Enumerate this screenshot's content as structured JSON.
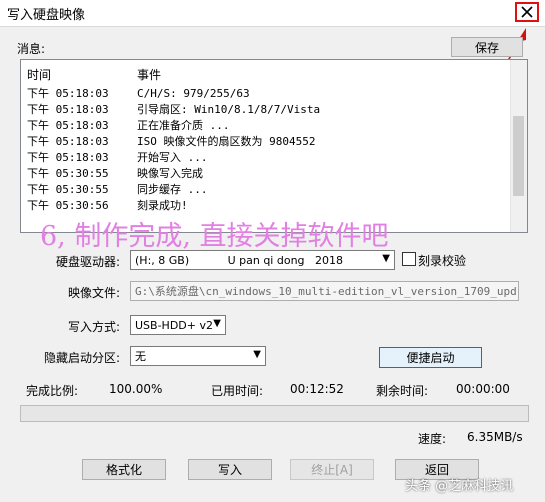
{
  "window": {
    "title": "写入硬盘映像"
  },
  "messages": {
    "label": "消息:",
    "save_label": "保存",
    "columns": {
      "time": "时间",
      "event": "事件"
    },
    "rows": [
      {
        "time": "下午 05:18:03",
        "event": "C/H/S: 979/255/63"
      },
      {
        "time": "下午 05:18:03",
        "event": "引导扇区: Win10/8.1/8/7/Vista"
      },
      {
        "time": "下午 05:18:03",
        "event": "正在准备介质 ..."
      },
      {
        "time": "下午 05:18:03",
        "event": "ISO 映像文件的扇区数为 9804552"
      },
      {
        "time": "下午 05:18:03",
        "event": "开始写入 ..."
      },
      {
        "time": "下午 05:30:55",
        "event": "映像写入完成"
      },
      {
        "time": "下午 05:30:55",
        "event": "同步缓存 ..."
      },
      {
        "time": "下午 05:30:56",
        "event": "刻录成功!"
      }
    ]
  },
  "overlay_text": "6, 制作完成, 直接关掉软件吧",
  "form": {
    "drive_label": "硬盘驱动器:",
    "drive_value": "(H:, 8 GB)           U pan qi dong   2018",
    "verify_label": "刻录校验",
    "image_label": "映像文件:",
    "image_value": "G:\\系统源盘\\cn_windows_10_multi-edition_vl_version_1709_upd",
    "mode_label": "写入方式:",
    "mode_value": "USB-HDD+ v2",
    "hidden_label": "隐藏启动分区:",
    "hidden_value": "无",
    "quick_start_label": "便捷启动"
  },
  "status": {
    "ratio_label": "完成比例:",
    "ratio_value": "100.00%",
    "elapsed_label": "已用时间:",
    "elapsed_value": "00:12:52",
    "remaining_label": "剩余时间:",
    "remaining_value": "00:00:00",
    "progress_fraction": 0.0,
    "speed_label": "速度:",
    "speed_value": "6.35MB/s"
  },
  "buttons": {
    "format": "格式化",
    "write": "写入",
    "stop": "终止[A]",
    "back": "返回"
  },
  "watermark": "头条 @芝麻科技讯",
  "colors": {
    "annotation_red": "#d11111",
    "overlay_pink": "#e27fe3",
    "accent_blue": "#0078d7"
  }
}
